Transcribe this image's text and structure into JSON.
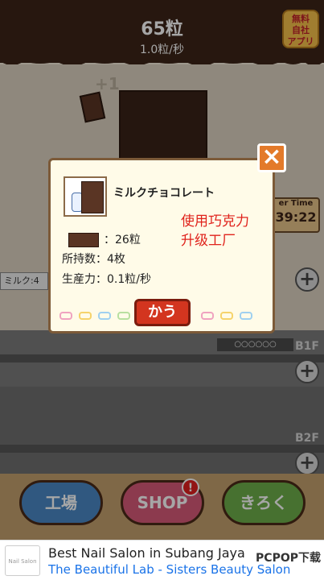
{
  "header": {
    "count": "65粒",
    "rate": "1.0粒/秒",
    "free_app_line1": "無料",
    "free_app_line2": "自社",
    "free_app_line3": "アプリ"
  },
  "game": {
    "plus_one": "+1",
    "timer_label": "er Time",
    "timer_value": "39:22",
    "milk_label": "ミルク:4",
    "counter_strip": "○○○○○○",
    "floors": [
      "B1F",
      "B2F"
    ]
  },
  "modal": {
    "item_name": "ミルクチョコレート",
    "cost": "：26粒",
    "owned_label": "所持数：4枚",
    "production_label": "生産力：0.1粒/秒",
    "note_line1": "使用巧克力",
    "note_line2": "升级工厂",
    "buy_label": "かう"
  },
  "nav": {
    "factory": "工場",
    "shop": "SHOP",
    "record": "きろく",
    "shop_badge": "!"
  },
  "ad": {
    "logo_text": "Nail Salon",
    "title": "Best Nail Salon in Subang Jaya",
    "subtitle": "The Beautiful Lab - Sisters Beauty Salon"
  },
  "watermark": "PCPOP下载",
  "colors": {
    "chocolate": "#3a2218",
    "accent_red": "#d3351f",
    "note_red": "#e0231c",
    "close_orange": "#e37a2a"
  }
}
